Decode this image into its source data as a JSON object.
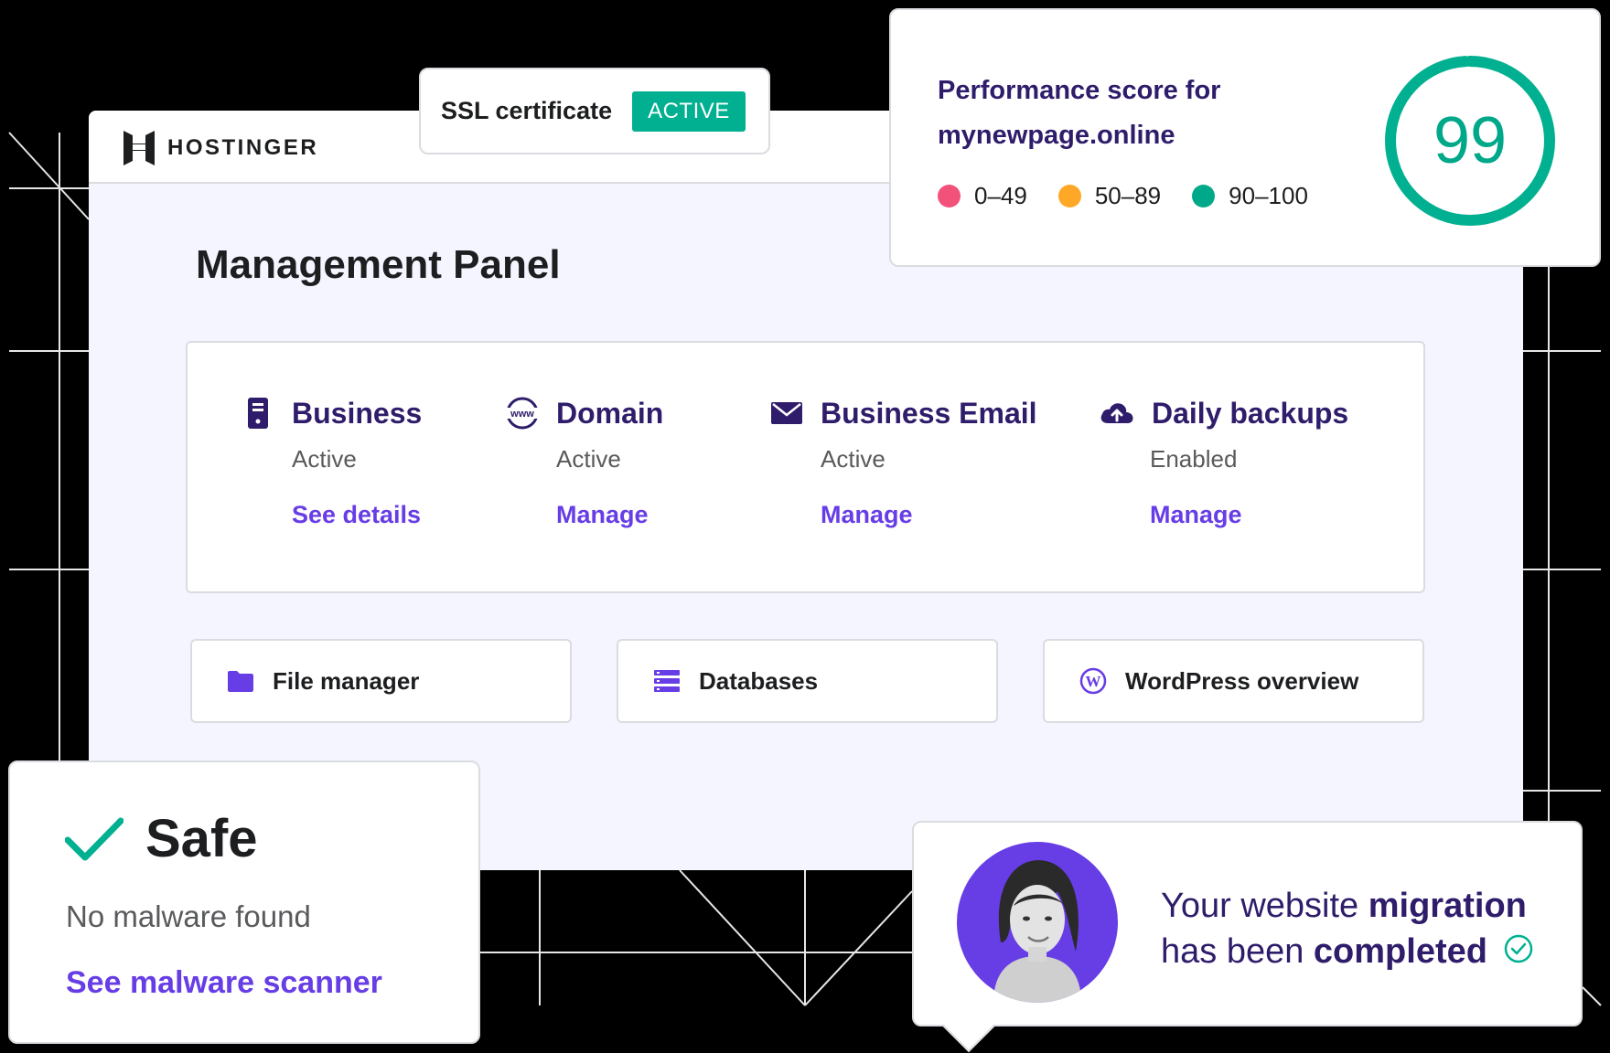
{
  "brand": {
    "name": "HOSTINGER",
    "logo_icon": "hostinger-logo-icon"
  },
  "ssl": {
    "label": "SSL certificate",
    "badge": "ACTIVE"
  },
  "performance": {
    "title_line1": "Performance score for",
    "title_line2": "mynewpage.online",
    "score": "99",
    "score_fraction": 0.99,
    "legend": [
      {
        "label": "0–49",
        "color": "#f2517a"
      },
      {
        "label": "50–89",
        "color": "#ffa726"
      },
      {
        "label": "90–100",
        "color": "#00a88a"
      }
    ],
    "gauge_color": "#00b090"
  },
  "panel": {
    "title": "Management Panel",
    "services": [
      {
        "name": "Business",
        "status": "Active",
        "link": "See details",
        "icon": "server-icon"
      },
      {
        "name": "Domain",
        "status": "Active",
        "link": "Manage",
        "icon": "www-globe-icon"
      },
      {
        "name": "Business Email",
        "status": "Active",
        "link": "Manage",
        "icon": "envelope-icon"
      },
      {
        "name": "Daily backups",
        "status": "Enabled",
        "link": "Manage",
        "icon": "cloud-upload-icon"
      }
    ],
    "tiles": [
      {
        "label": "File manager",
        "icon": "folder-icon"
      },
      {
        "label": "Databases",
        "icon": "database-icon"
      },
      {
        "label": "WordPress overview",
        "icon": "wordpress-icon"
      }
    ]
  },
  "safe": {
    "title": "Safe",
    "subtitle": "No malware found",
    "link": "See malware scanner"
  },
  "migration": {
    "part1": "Your website ",
    "bold1": "migration",
    "part2": "has been ",
    "bold2": "completed"
  },
  "colors": {
    "accent": "#673de6",
    "navy": "#2f1c6a",
    "success": "#00b090"
  }
}
